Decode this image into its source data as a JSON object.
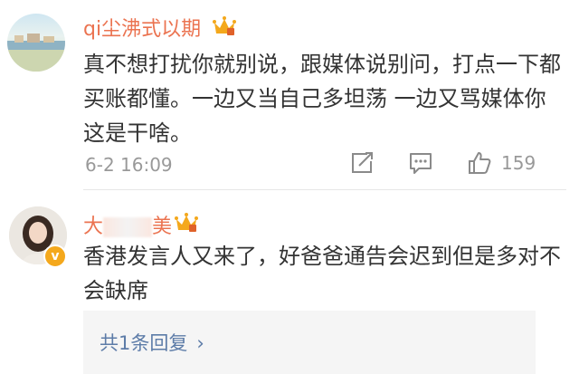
{
  "comments": [
    {
      "username": "qi尘沸式以期",
      "text": "真不想打扰你就别说，跟媒体说别问，打点一下都买账都懂。一边又当自己多坦荡 一边又骂媒体你这是干啥。",
      "time": "6-2 16:09",
      "likes": "159",
      "icons": [
        "repost-icon",
        "comment-icon",
        "like-icon"
      ]
    },
    {
      "username_prefix": "大",
      "username_suffix": "美",
      "text": "香港发言人又来了，好爸爸通告会迟到但是多对不会缺席",
      "replies_label": "共1条回复",
      "reply_chevron": "›",
      "verified_badge": "v"
    }
  ],
  "colors": {
    "username": "#eb7350",
    "link": "#5d7ca8",
    "meta": "#999999",
    "crown": "#f4a81c"
  }
}
